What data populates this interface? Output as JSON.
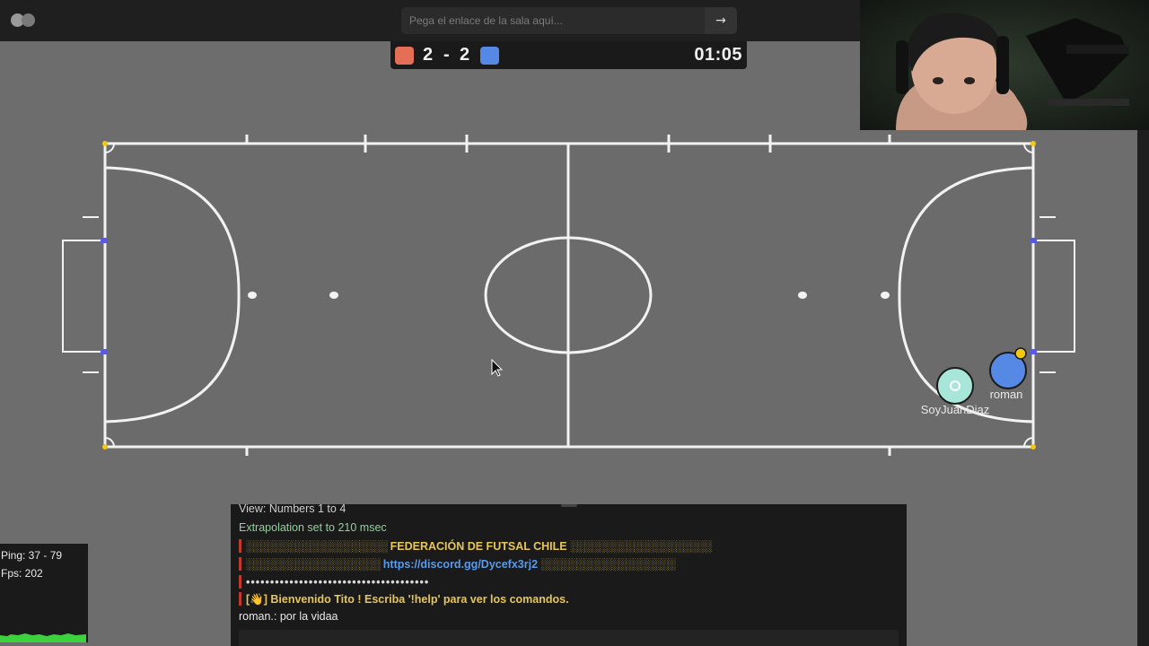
{
  "topbar": {
    "logo_icon": "haxball-logo-icon",
    "room_input_placeholder": "Pega el enlace de la sala aquí...",
    "go_button_icon": "→"
  },
  "scoreboard": {
    "red_color": "#e56e56",
    "blue_color": "#5689e5",
    "red_score": "2",
    "separator": "-",
    "blue_score": "2",
    "timer": "01:05"
  },
  "field": {
    "players": [
      {
        "name": "SoyJuanDiaz",
        "team": "spectator",
        "color": "#a8e6d9"
      },
      {
        "name": "roman",
        "team": "blue",
        "color": "#5689e5"
      }
    ],
    "ball_color": "#f2c811"
  },
  "stats": {
    "ping": "Ping: 37 - 79",
    "fps": "Fps: 202"
  },
  "chat": {
    "line0": "View: Numbers 1 to 4",
    "line1": "Extrapolation set to 210 msec",
    "line2_hatch_left": "░░░░░░░░░░░░░░░░░░░░",
    "line2_title": "FEDERACIÓN DE FUTSAL CHILE",
    "line2_hatch_right": "░░░░░░░░░░░░░░░░░░░░",
    "line3_hatch_left": "░░░░░░░░░░░░░░░░░░░",
    "line3_link": "https://discord.gg/Dycefx3rj2",
    "line3_hatch_right": "░░░░░░░░░░░░░░░░░░░",
    "line4": "••••••••••••••••••••••••••••••••••••••",
    "line5_prefix": "[👋]",
    "line5_text": "Bienvenido Tito ! Escriba '!help' para ver los comandos.",
    "line6": "roman.: por la vidaa"
  }
}
